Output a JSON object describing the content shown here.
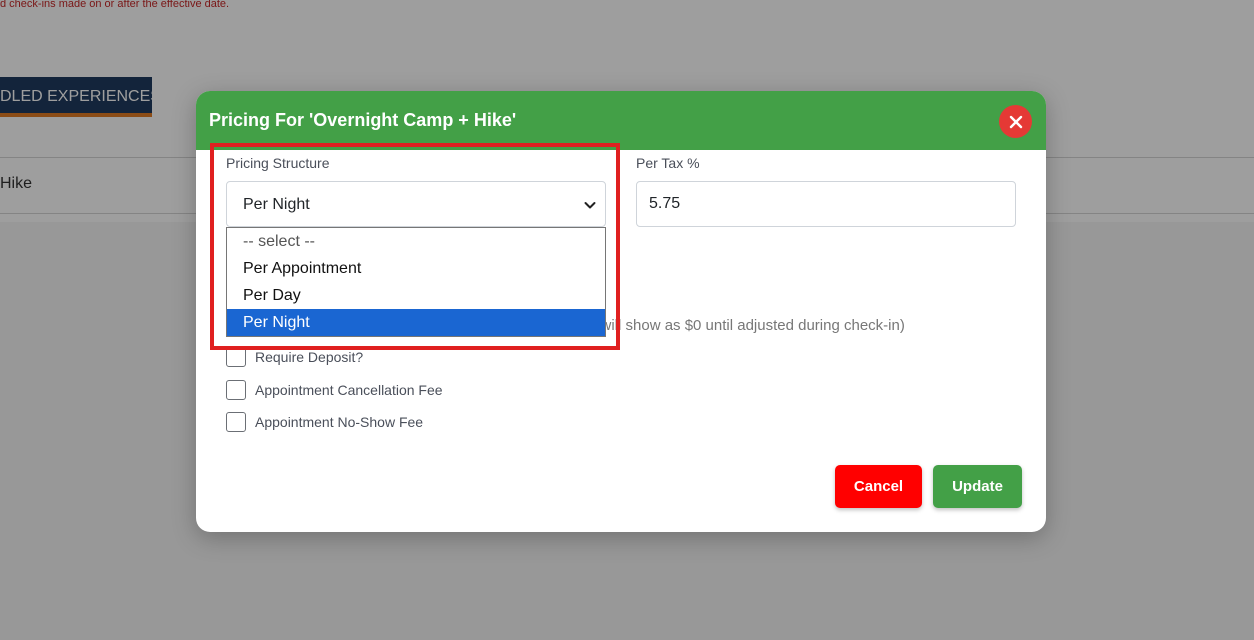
{
  "background": {
    "notice": "d check-ins made on or after the effective date.",
    "tab_label": "DLED EXPERIENCES",
    "row_text": "Hike"
  },
  "modal": {
    "title": "Pricing For 'Overnight Camp + Hike'",
    "close_icon": "close-icon",
    "pricing_structure": {
      "label": "Pricing Structure",
      "selected": "Per Night",
      "options": [
        "-- select --",
        "Per Appointment",
        "Per Day",
        "Per Night"
      ]
    },
    "tax": {
      "label": "Per Tax %",
      "value": "5.75"
    },
    "hint_partial": "e will show as $0 until adjusted during check-in)",
    "checkboxes": [
      {
        "label": "Require Deposit?",
        "checked": false
      },
      {
        "label": "Appointment Cancellation Fee",
        "checked": false
      },
      {
        "label": "Appointment No-Show Fee",
        "checked": false
      }
    ],
    "buttons": {
      "cancel": "Cancel",
      "update": "Update"
    }
  },
  "colors": {
    "header_green": "#43a047",
    "close_red": "#e53935",
    "cancel_red": "#ff0000",
    "selected_blue": "#1a66d2",
    "highlight_red": "#e02020"
  }
}
